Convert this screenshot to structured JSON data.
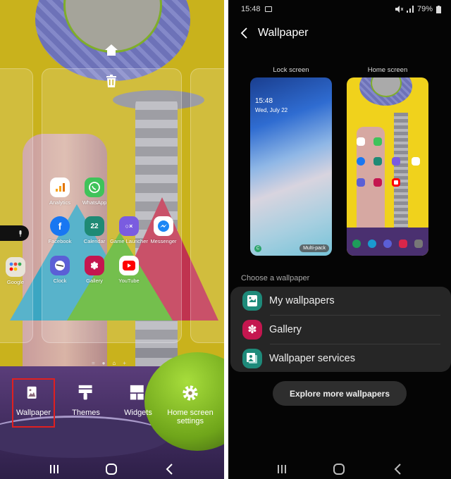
{
  "left_screen": {
    "apps": [
      {
        "label": "Analytics",
        "icon": "analytics-icon",
        "color": "#ffffff"
      },
      {
        "label": "WhatsApp",
        "icon": "whatsapp-icon",
        "color": "#3fc35a"
      },
      {
        "label": "Facebook",
        "icon": "facebook-icon",
        "color": "#1877f2"
      },
      {
        "label": "Calendar",
        "icon": "calendar-icon",
        "color": "#1f8a75"
      },
      {
        "label": "Game Launcher",
        "icon": "game-launcher-icon",
        "color": "#7a5ce0"
      },
      {
        "label": "Messenger",
        "icon": "messenger-icon",
        "color": "#ffffff"
      },
      {
        "label": "Clock",
        "icon": "clock-icon",
        "color": "#5b5fd6"
      },
      {
        "label": "Gallery",
        "icon": "gallery-icon",
        "color": "#c4164f"
      },
      {
        "label": "YouTube",
        "icon": "youtube-icon",
        "color": "#ffffff"
      }
    ],
    "folder": {
      "label": "Google"
    },
    "calendar_day": "22",
    "menu": [
      {
        "label": "Wallpaper",
        "icon": "wallpaper-icon"
      },
      {
        "label": "Themes",
        "icon": "themes-icon"
      },
      {
        "label": "Widgets",
        "icon": "widgets-icon"
      },
      {
        "label": "Home screen settings",
        "icon": "gear-icon"
      }
    ],
    "highlight_color": "#e02020"
  },
  "right_screen": {
    "status": {
      "time": "15:48",
      "battery": "79%"
    },
    "title": "Wallpaper",
    "previews": {
      "lock_label": "Lock screen",
      "home_label": "Home screen",
      "lock_time": "15:48",
      "lock_date": "Wed, July 22",
      "multipack": "Multi-pack"
    },
    "section_label": "Choose a wallpaper",
    "options": [
      {
        "label": "My wallpapers",
        "icon": "my-wallpapers-icon",
        "color": "#1e8a7a"
      },
      {
        "label": "Gallery",
        "icon": "gallery-icon",
        "color": "#c4164f"
      },
      {
        "label": "Wallpaper services",
        "icon": "wallpaper-services-icon",
        "color": "#1e8a7a"
      }
    ],
    "explore_button": "Explore more wallpapers"
  }
}
